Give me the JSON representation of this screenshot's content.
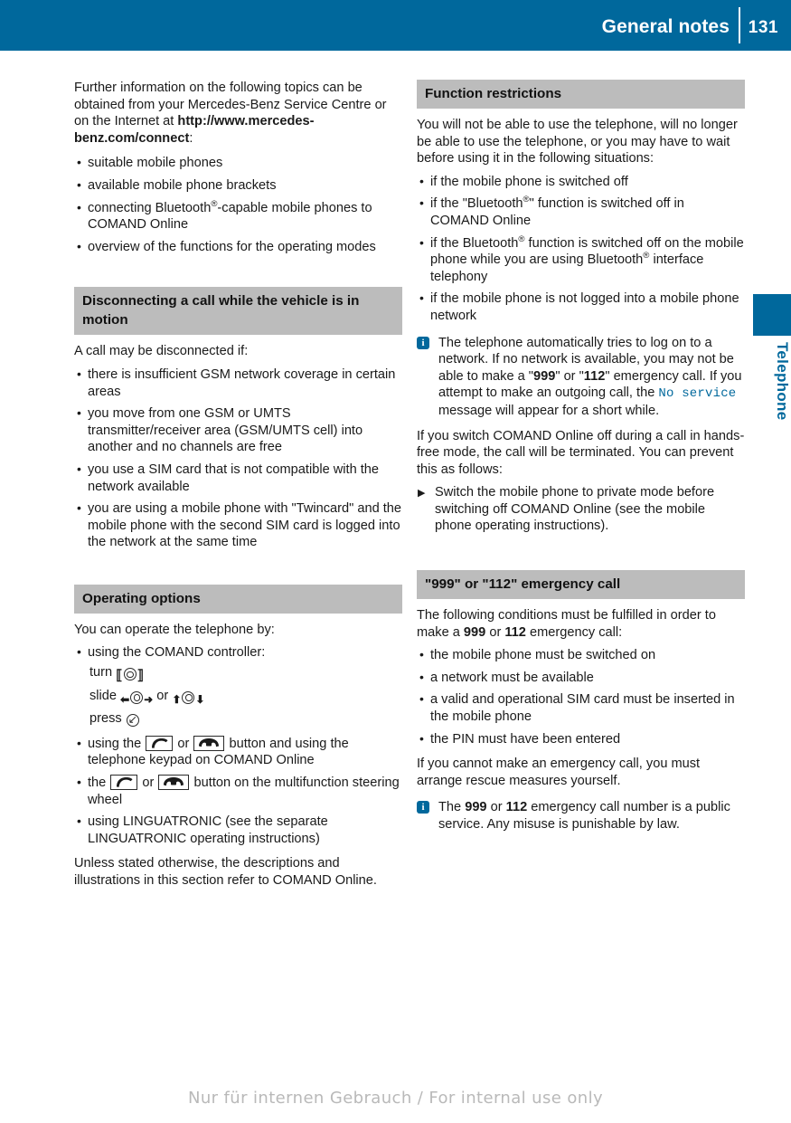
{
  "header": {
    "title": "General notes",
    "page_number": "131"
  },
  "side_tab": {
    "label": "Telephone",
    "color": "#00689c"
  },
  "colors": {
    "accent": "#00689c",
    "section_header_bg": "#bcbcbc",
    "watermark": "#b9b9b9"
  },
  "left_column": {
    "intro_para_1": "Further information on the following topics can be obtained from your Mercedes-Benz Service Centre or on the Internet at ",
    "intro_url": "http://www.mercedes-benz.com/connect",
    "intro_para_end": ":",
    "intro_bullets": [
      "suitable mobile phones",
      "available mobile phone brackets",
      "connecting Bluetooth®-capable mobile phones to COMAND Online",
      "overview of the functions for the operating modes"
    ],
    "disconnect_section": {
      "heading": "Disconnecting a call while the vehicle is in motion",
      "intro": "A call may be disconnected if:",
      "bullets": [
        "there is insufficient GSM network coverage in certain areas",
        "you move from one GSM or UMTS transmitter/receiver area (GSM/UMTS cell) into another and no channels are free",
        "you use a SIM card that is not compatible with the network available",
        "you are using a mobile phone with \"Twincard\" and the mobile phone with the second SIM card is logged into the network at the same time"
      ]
    },
    "operating_section": {
      "heading": "Operating options",
      "intro": "You can operate the telephone by:",
      "bullet_controller": "using the COMAND controller:",
      "controller_turn_label": "turn",
      "controller_slide_label": "slide",
      "controller_slide_or": "or",
      "controller_press_label": "press",
      "bullet_button_pre": "using the",
      "bullet_button_or": "or",
      "bullet_button_post": "button and using the telephone keypad on COMAND Online",
      "bullet_mfsw_pre": "the",
      "bullet_mfsw_or": "or",
      "bullet_mfsw_post": "button on the multifunction steering wheel",
      "bullet_linguatronic": "using LINGUATRONIC (see the separate LINGUATRONIC operating instructions)",
      "closing": "Unless stated otherwise, the descriptions and illustrations in this section refer to COMAND Online."
    }
  },
  "right_column": {
    "restrictions_section": {
      "heading": "Function restrictions",
      "intro": "You will not be able to use the telephone, will no longer be able to use the telephone, or you may have to wait before using it in the following situations:",
      "bullets": [
        "if the mobile phone is switched off",
        "if the \"Bluetooth®\" function is switched off in COMAND Online",
        "if the Bluetooth® function is switched off on the mobile phone while you are using Bluetooth® interface telephony",
        "if the mobile phone is not logged into a mobile phone network"
      ],
      "note_part_1": "The telephone automatically tries to log on to a network. If no network is available, you may not be able to make a \"",
      "note_num_999": "999",
      "note_part_2": "\" or \"",
      "note_num_112": "112",
      "note_part_3": "\" emergency call. If you attempt to make an outgoing call, the ",
      "note_display_text": "No service",
      "note_part_4": " message will appear for a short while.",
      "after_note": "If you switch COMAND Online off during a call in hands-free mode, the call will be terminated. You can prevent this as follows:",
      "action": "Switch the mobile phone to private mode before switching off COMAND Online (see the mobile phone operating instructions)."
    },
    "emergency_section": {
      "heading": "\"999\" or \"112\" emergency call",
      "intro_part_1": "The following conditions must be fulfilled in order to make a ",
      "intro_num_999": "999",
      "intro_or": " or ",
      "intro_num_112": "112",
      "intro_part_2": " emergency call:",
      "bullets": [
        "the mobile phone must be switched on",
        "a network must be available",
        "a valid and operational SIM card must be inserted in the mobile phone",
        "the PIN must have been entered"
      ],
      "closing": "If you cannot make an emergency call, you must arrange rescue measures yourself.",
      "note_part_1": "The ",
      "note_num_999": "999",
      "note_or": " or ",
      "note_num_112": "112",
      "note_part_2": " emergency call number is a public service. Any misuse is punishable by law."
    }
  },
  "footer": {
    "watermark": "Nur für internen Gebrauch / For internal use only"
  }
}
